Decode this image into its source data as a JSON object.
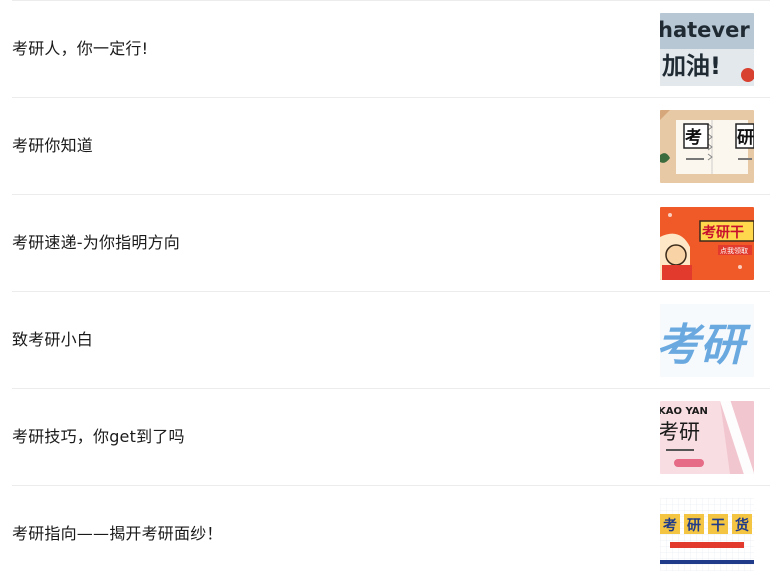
{
  "articles": [
    {
      "title": "考研人，你一定行!",
      "thumb_text_1": "hatever",
      "thumb_text_2": "加油!",
      "thumb_icon": "whatever-cheer-thumbnail"
    },
    {
      "title": "考研你知道",
      "thumb_text_1": "考",
      "thumb_text_2": "研",
      "thumb_icon": "kaoyan-notebook-thumbnail"
    },
    {
      "title": "考研速递-为你指明方向",
      "thumb_text_1": "考研干",
      "thumb_text_2": "点我领取",
      "thumb_icon": "kaoyan-cartoon-thumbnail"
    },
    {
      "title": "致考研小白",
      "thumb_text_1": "考研",
      "thumb_icon": "kaoyan-calligraphy-thumbnail"
    },
    {
      "title": "考研技巧，你get到了吗",
      "thumb_text_1": "KAO YAN",
      "thumb_text_2": "考研",
      "thumb_icon": "kaoyan-pen-thumbnail"
    },
    {
      "title": "考研指向——揭开考研面纱！",
      "thumb_text_1": "考",
      "thumb_text_2": "研",
      "thumb_text_3": "干",
      "thumb_text_4": "货",
      "thumb_icon": "kaoyan-grid-thumbnail"
    }
  ],
  "colors": {
    "text": "#1a1a1a",
    "divider": "#ececec",
    "accent_orange": "#f05a28",
    "accent_blue": "#4a90d9",
    "accent_pink": "#f2c6cf"
  }
}
